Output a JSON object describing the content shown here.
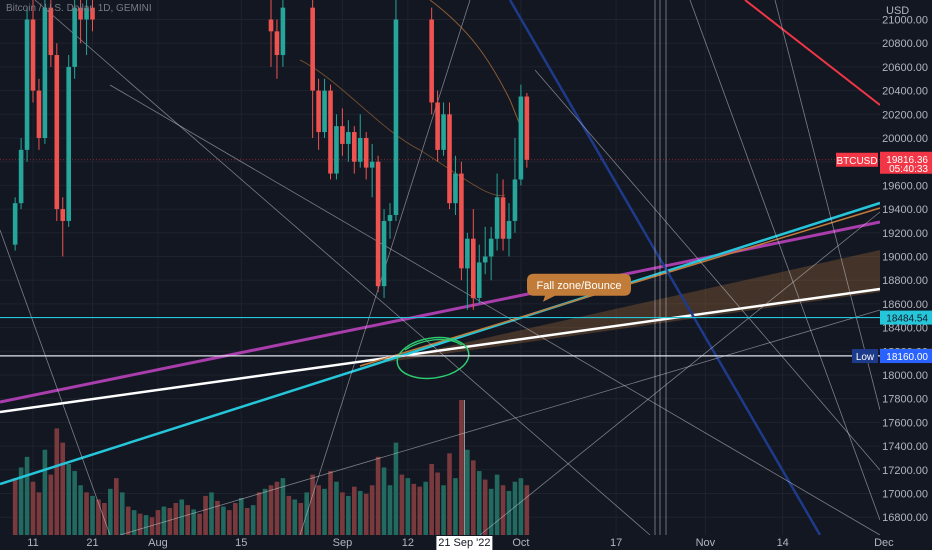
{
  "header": {
    "symbol_title": "Bitcoin / U.S. Dollar, 1D, GEMINI"
  },
  "price_axis": {
    "currency": "USD"
  },
  "chart_data": {
    "type": "candlestick",
    "title": "Bitcoin / U.S. Dollar, 1D, GEMINI",
    "ylabel": "USD",
    "ylim": [
      16650,
      21200
    ],
    "y_ticks": [
      21000,
      20800,
      20600,
      20400,
      20200,
      20000,
      19800,
      19600,
      19400,
      19200,
      19000,
      18800,
      18600,
      18400,
      18200,
      18000,
      17800,
      17600,
      17400,
      17200,
      17000,
      16800
    ],
    "y_tick_labels": [
      "21000.00",
      "20800.00",
      "20600.00",
      "20400.00",
      "20200.00",
      "20000.00",
      "19800.00",
      "19600.00",
      "19400.00",
      "19200.00",
      "19000.00",
      "18800.00",
      "18600.00",
      "18400.00",
      "18200.00",
      "18000.00",
      "17800.00",
      "17600.00",
      "17400.00",
      "17200.00",
      "17000.00",
      "16800.00"
    ],
    "x_ticks": [
      {
        "label": "11",
        "day": 0
      },
      {
        "label": "21",
        "day": 10
      },
      {
        "label": "Aug",
        "day": 21
      },
      {
        "label": "15",
        "day": 35
      },
      {
        "label": "Sep",
        "day": 52
      },
      {
        "label": "12",
        "day": 63
      },
      {
        "label": "Oct",
        "day": 82
      },
      {
        "label": "17",
        "day": 98
      },
      {
        "label": "Nov",
        "day": 113
      },
      {
        "label": "14",
        "day": 126
      },
      {
        "label": "Dec",
        "day": 143
      }
    ],
    "x_date_tag": {
      "label": "21 Sep '22",
      "day": 72
    },
    "day_range": [
      -4,
      146
    ],
    "candles": [
      [
        -3,
        19100,
        19500,
        19050,
        19450
      ],
      [
        -2,
        19450,
        20000,
        19400,
        19900
      ],
      [
        -1,
        19900,
        21100,
        19800,
        21000
      ],
      [
        0,
        21000,
        21200,
        20300,
        20400
      ],
      [
        1,
        20400,
        20500,
        19900,
        20000
      ],
      [
        2,
        20000,
        21200,
        19950,
        21100
      ],
      [
        3,
        21100,
        21200,
        20600,
        20700
      ],
      [
        4,
        20700,
        20800,
        19300,
        19400
      ],
      [
        5,
        19400,
        19500,
        19000,
        19300
      ],
      [
        6,
        19300,
        20700,
        19250,
        20600
      ],
      [
        7,
        20600,
        21200,
        20500,
        21100
      ],
      [
        8,
        21100,
        21200,
        20800,
        21000
      ],
      [
        9,
        21000,
        21200,
        20700,
        21100
      ],
      [
        10,
        21100,
        21200,
        20900,
        21000
      ],
      [
        40,
        21000,
        21200,
        20600,
        20900
      ],
      [
        41,
        20900,
        21000,
        20500,
        20700
      ],
      [
        42,
        20700,
        21200,
        20600,
        21100
      ],
      [
        47,
        21100,
        21200,
        20000,
        20400
      ],
      [
        48,
        20400,
        20500,
        19900,
        20050
      ],
      [
        49,
        20050,
        20500,
        20000,
        20400
      ],
      [
        50,
        20400,
        20450,
        19650,
        19700
      ],
      [
        51,
        19700,
        20200,
        19650,
        20100
      ],
      [
        52,
        20100,
        20250,
        19850,
        19950
      ],
      [
        53,
        19950,
        20150,
        19800,
        20050
      ],
      [
        54,
        20050,
        20100,
        19700,
        19800
      ],
      [
        55,
        19800,
        20200,
        19750,
        20000
      ],
      [
        56,
        20000,
        20050,
        19650,
        19750
      ],
      [
        57,
        19750,
        19950,
        19500,
        19800
      ],
      [
        58,
        19800,
        19850,
        18700,
        18750
      ],
      [
        59,
        18750,
        19400,
        18650,
        19300
      ],
      [
        60,
        19300,
        19450,
        19150,
        19350
      ],
      [
        61,
        19350,
        21200,
        19300,
        21000
      ],
      [
        67,
        21000,
        21100,
        20200,
        20300
      ],
      [
        68,
        20300,
        20400,
        19800,
        19900
      ],
      [
        69,
        19900,
        20300,
        19850,
        20200
      ],
      [
        70,
        20200,
        20300,
        19400,
        19450
      ],
      [
        71,
        19450,
        19850,
        19350,
        19700
      ],
      [
        72,
        19700,
        19800,
        18800,
        18900
      ],
      [
        73,
        18900,
        19200,
        18550,
        19150
      ],
      [
        74,
        19150,
        19400,
        18550,
        18650
      ],
      [
        75,
        18650,
        19100,
        18600,
        18950
      ],
      [
        76,
        18950,
        19250,
        18850,
        19000
      ],
      [
        77,
        19000,
        19250,
        18800,
        19150
      ],
      [
        78,
        19150,
        19700,
        19050,
        19500
      ],
      [
        79,
        19500,
        19650,
        19050,
        19150
      ],
      [
        80,
        19150,
        19450,
        19000,
        19300
      ],
      [
        81,
        19300,
        20000,
        19200,
        19650
      ],
      [
        82,
        19650,
        20450,
        19600,
        20350
      ],
      [
        83,
        20350,
        20380,
        19750,
        19816
      ]
    ],
    "volumes": [
      [
        -3,
        80,
        "d"
      ],
      [
        -2,
        95,
        "u"
      ],
      [
        -1,
        110,
        "u"
      ],
      [
        0,
        75,
        "d"
      ],
      [
        1,
        60,
        "d"
      ],
      [
        2,
        120,
        "u"
      ],
      [
        3,
        85,
        "d"
      ],
      [
        4,
        150,
        "d"
      ],
      [
        5,
        130,
        "d"
      ],
      [
        6,
        100,
        "u"
      ],
      [
        7,
        90,
        "u"
      ],
      [
        8,
        70,
        "u"
      ],
      [
        9,
        60,
        "d"
      ],
      [
        10,
        55,
        "u"
      ],
      [
        11,
        50,
        "d"
      ],
      [
        12,
        45,
        "d"
      ],
      [
        13,
        65,
        "u"
      ],
      [
        14,
        80,
        "d"
      ],
      [
        15,
        60,
        "u"
      ],
      [
        16,
        40,
        "d"
      ],
      [
        17,
        35,
        "u"
      ],
      [
        18,
        30,
        "d"
      ],
      [
        19,
        28,
        "u"
      ],
      [
        20,
        25,
        "d"
      ],
      [
        21,
        35,
        "d"
      ],
      [
        22,
        40,
        "u"
      ],
      [
        23,
        38,
        "d"
      ],
      [
        24,
        45,
        "d"
      ],
      [
        25,
        50,
        "u"
      ],
      [
        26,
        42,
        "d"
      ],
      [
        27,
        36,
        "u"
      ],
      [
        28,
        30,
        "d"
      ],
      [
        29,
        55,
        "d"
      ],
      [
        30,
        60,
        "u"
      ],
      [
        31,
        48,
        "d"
      ],
      [
        32,
        40,
        "u"
      ],
      [
        33,
        35,
        "d"
      ],
      [
        34,
        45,
        "d"
      ],
      [
        35,
        52,
        "u"
      ],
      [
        36,
        38,
        "d"
      ],
      [
        37,
        42,
        "u"
      ],
      [
        38,
        60,
        "d"
      ],
      [
        39,
        65,
        "u"
      ],
      [
        40,
        70,
        "d"
      ],
      [
        41,
        75,
        "d"
      ],
      [
        42,
        80,
        "u"
      ],
      [
        43,
        55,
        "d"
      ],
      [
        44,
        50,
        "u"
      ],
      [
        45,
        45,
        "d"
      ],
      [
        46,
        60,
        "u"
      ],
      [
        47,
        85,
        "d"
      ],
      [
        48,
        70,
        "d"
      ],
      [
        49,
        65,
        "u"
      ],
      [
        50,
        90,
        "d"
      ],
      [
        51,
        75,
        "u"
      ],
      [
        52,
        60,
        "d"
      ],
      [
        53,
        55,
        "u"
      ],
      [
        54,
        68,
        "d"
      ],
      [
        55,
        62,
        "u"
      ],
      [
        56,
        58,
        "d"
      ],
      [
        57,
        70,
        "d"
      ],
      [
        58,
        110,
        "d"
      ],
      [
        59,
        95,
        "u"
      ],
      [
        60,
        70,
        "u"
      ],
      [
        61,
        130,
        "u"
      ],
      [
        62,
        85,
        "d"
      ],
      [
        63,
        80,
        "u"
      ],
      [
        64,
        72,
        "d"
      ],
      [
        65,
        68,
        "d"
      ],
      [
        66,
        75,
        "u"
      ],
      [
        67,
        100,
        "d"
      ],
      [
        68,
        88,
        "d"
      ],
      [
        69,
        70,
        "u"
      ],
      [
        70,
        115,
        "d"
      ],
      [
        71,
        80,
        "u"
      ],
      [
        72,
        190,
        "d"
      ],
      [
        73,
        120,
        "u"
      ],
      [
        74,
        105,
        "d"
      ],
      [
        75,
        90,
        "u"
      ],
      [
        76,
        78,
        "d"
      ],
      [
        77,
        65,
        "u"
      ],
      [
        78,
        85,
        "u"
      ],
      [
        79,
        70,
        "d"
      ],
      [
        80,
        62,
        "u"
      ],
      [
        81,
        75,
        "u"
      ],
      [
        82,
        80,
        "u"
      ],
      [
        83,
        70,
        "d"
      ]
    ],
    "horizontal_lines": [
      {
        "price": 18484.54,
        "label": "18484.54",
        "color": "#26c6da"
      },
      {
        "price": 18161.15,
        "label": "18161.15",
        "color": "#e0e3eb"
      }
    ],
    "price_tags": [
      {
        "label": "19816.36",
        "sublabel": "05:40:33",
        "symbol": "BTCUSD",
        "price": 19816.36,
        "color": "#f23645"
      },
      {
        "label": "18160.00",
        "symbol": "Low",
        "price": 18160.0,
        "color": "#2962ff"
      }
    ],
    "annotation": {
      "text": "Fall zone/Bounce",
      "day": 80,
      "price": 18660
    }
  }
}
